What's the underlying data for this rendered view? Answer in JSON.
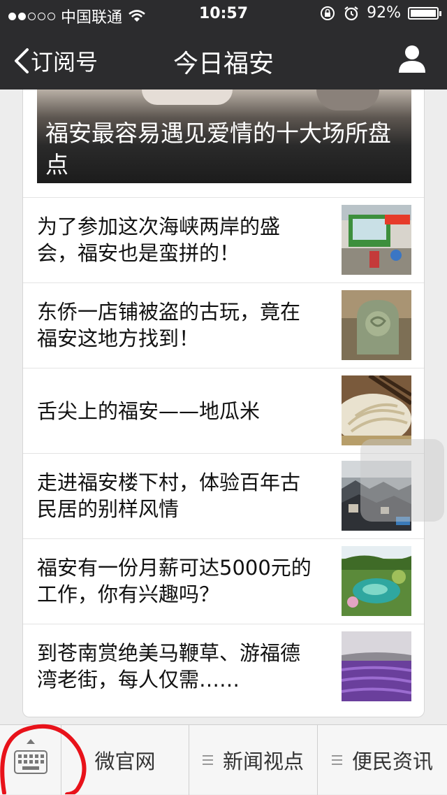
{
  "status": {
    "carrier": "中国联通",
    "time": "10:57",
    "battery": "92%",
    "battery_level": 0.92,
    "signal_filled": 2,
    "signal_total": 5
  },
  "nav": {
    "back_label": "订阅号",
    "title": "今日福安"
  },
  "hero": {
    "caption": "福安最容易遇见爱情的十大场所盘点"
  },
  "articles": [
    {
      "title": "为了参加这次海峡两岸的盛会，福安也是蛮拼的！"
    },
    {
      "title": "东侨一店铺被盗的古玩，竟在福安这地方找到！"
    },
    {
      "title": "舌尖上的福安——地瓜米"
    },
    {
      "title": "走进福安楼下村，体验百年古民居的别样风情"
    },
    {
      "title": "福安有一份月薪可达5000元的工作，你有兴趣吗？"
    },
    {
      "title": "到苍南赏绝美马鞭草、游福德湾老街，每人仅需……"
    }
  ],
  "menu": {
    "items": [
      "微官网",
      "新闻视点",
      "便民资讯"
    ]
  },
  "colors": {
    "nav_bg": "#2c2c2e",
    "annotation_red": "#e8121a"
  }
}
